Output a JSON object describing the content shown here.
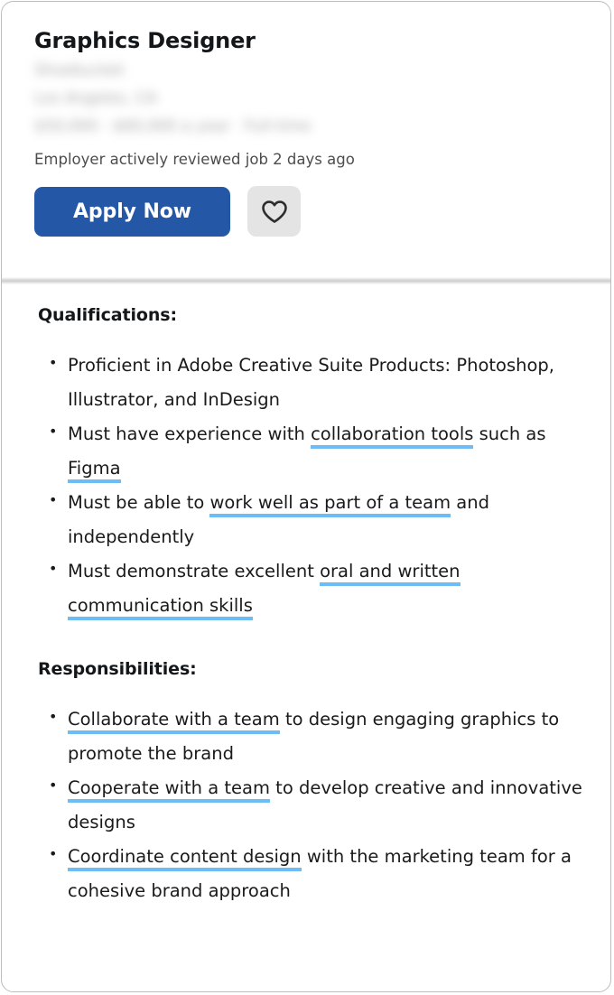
{
  "card": {
    "header": {
      "job_title": "Graphics Designer",
      "company_redacted": "Shoebucket",
      "location_redacted": "Los Angeles, CA",
      "salary_redacted": "$50,000 - $60,000 a year  ·  Full-time",
      "activity_note": "Employer actively reviewed job 2 days ago",
      "apply_label": "Apply Now",
      "save_icon": "heart-icon"
    },
    "sections": [
      {
        "heading": "Qualifications:",
        "bullets": [
          [
            {
              "text": "Proficient in Adobe Creative Suite Products: Photoshop, Illustrator, and InDesign",
              "highlight": false
            }
          ],
          [
            {
              "text": "Must have experience with ",
              "highlight": false
            },
            {
              "text": "collaboration tools",
              "highlight": true
            },
            {
              "text": " such as ",
              "highlight": false
            },
            {
              "text": "Figma",
              "highlight": true
            }
          ],
          [
            {
              "text": "Must be able to ",
              "highlight": false
            },
            {
              "text": "work well as part of a team",
              "highlight": true
            },
            {
              "text": " and independently",
              "highlight": false
            }
          ],
          [
            {
              "text": "Must demonstrate excellent ",
              "highlight": false
            },
            {
              "text": "oral and written communication skills",
              "highlight": true
            }
          ]
        ]
      },
      {
        "heading": "Responsibilities:",
        "bullets": [
          [
            {
              "text": "Collaborate with a team",
              "highlight": true
            },
            {
              "text": " to design engaging graphics to promote the brand",
              "highlight": false
            }
          ],
          [
            {
              "text": "Cooperate with a team",
              "highlight": true
            },
            {
              "text": " to develop creative and innovative designs",
              "highlight": false
            }
          ],
          [
            {
              "text": "Coordinate content design",
              "highlight": true
            },
            {
              "text": " with the marketing team for a cohesive brand approach",
              "highlight": false
            }
          ]
        ]
      }
    ]
  },
  "colors": {
    "apply_button": "#2557A7",
    "highlight_underline": "#6CBDF5",
    "save_button_bg": "#E4E4E4",
    "card_border": "#BDBDBD",
    "title_text": "#13171A",
    "body_text": "#1A1A1A",
    "muted_text": "#4D4D4D"
  }
}
